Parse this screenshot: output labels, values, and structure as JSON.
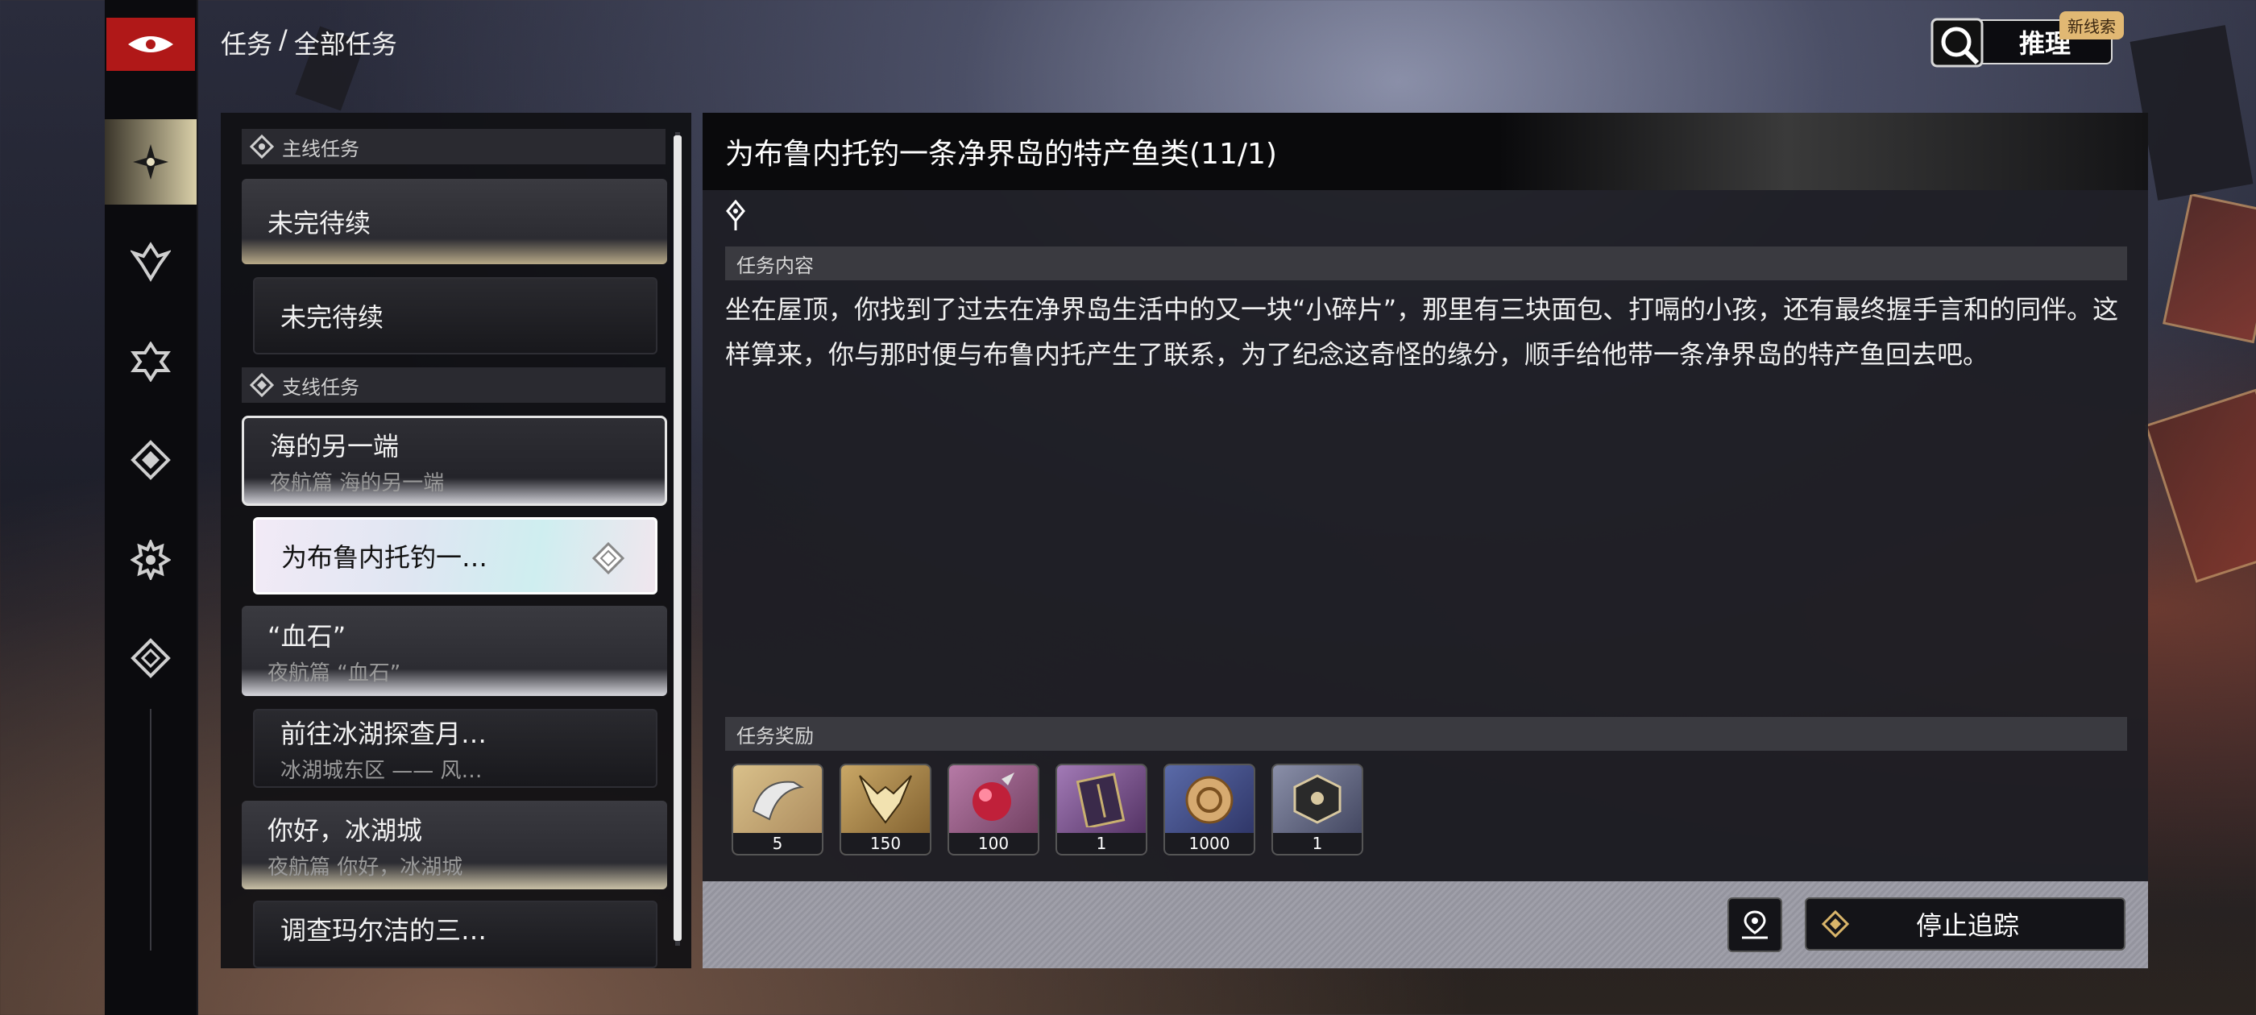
{
  "breadcrumb": {
    "section": "任务",
    "separator": "/",
    "current": "全部任务"
  },
  "reasoning": {
    "label": "推理",
    "badge": "新线索"
  },
  "rail": {
    "items": [
      "star-icon",
      "wing-icon",
      "badge-icon",
      "diamond-icon",
      "gear-icon",
      "compass-icon"
    ],
    "active": 0
  },
  "list": {
    "main_section": "主线任务",
    "main_card": {
      "title": "未完待续"
    },
    "main_sub": {
      "title": "未完待续"
    },
    "side_section": "支线任务",
    "cards": [
      {
        "title": "海的另一端",
        "subtitle": "夜航篇 海的另一端"
      },
      {
        "title": "为布鲁内托钓一…"
      },
      {
        "title": "“血石”",
        "subtitle": "夜航篇 “血石”"
      },
      {
        "title": "前往冰湖探查月…",
        "subtitle": "冰湖城东区 —— 风…"
      },
      {
        "title": "你好，冰湖城",
        "subtitle": "夜航篇 你好，冰湖城"
      },
      {
        "title": "调查玛尔洁的三…"
      }
    ]
  },
  "detail": {
    "title": "为布鲁内托钓一条净界岛的特产鱼类(11/1)",
    "content_label": "任务内容",
    "description": "坐在屋顶，你找到了过去在净界岛生活中的又一块“小碎片”，那里有三块面包、打嗝的小孩，还有最终握手言和的同伴。这样算来，你与那时便与布鲁内托产生了联系，为了纪念这奇怪的缘分，顺手给他带一条净界岛的特产鱼回去吧。",
    "rewards_label": "任务奖励",
    "rewards": [
      {
        "icon": "scroll-icon",
        "count": "5"
      },
      {
        "icon": "horned-helm-icon",
        "count": "150"
      },
      {
        "icon": "red-orb-icon",
        "count": "100"
      },
      {
        "icon": "book-icon",
        "count": "1"
      },
      {
        "icon": "coin-icon",
        "count": "1000"
      },
      {
        "icon": "dice-icon",
        "count": "1"
      }
    ],
    "stop_label": "停止追踪"
  }
}
